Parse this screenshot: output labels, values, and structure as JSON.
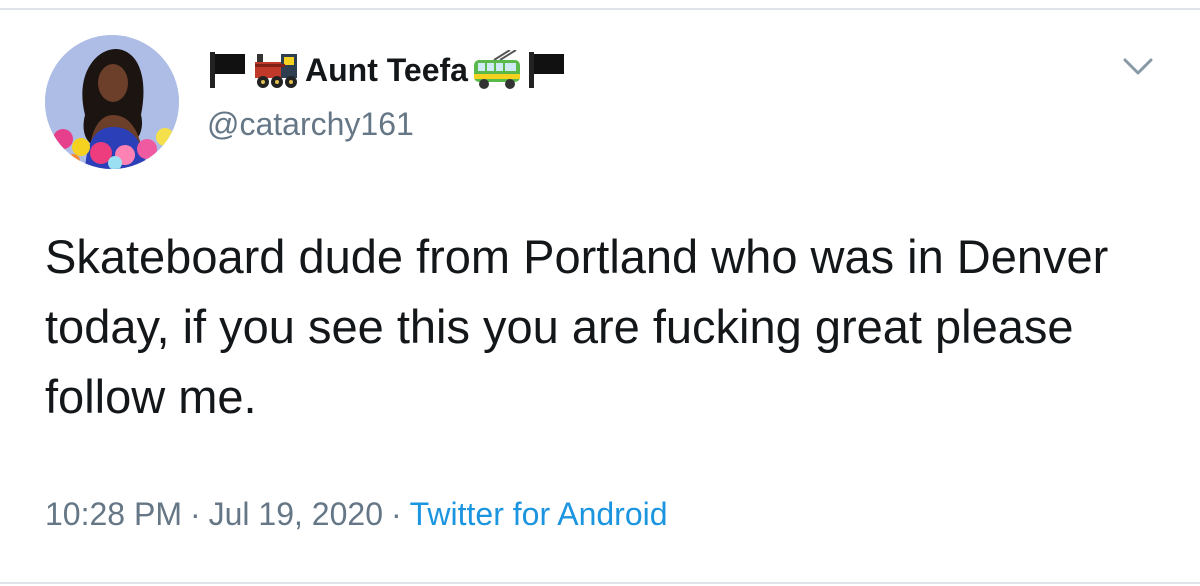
{
  "tweet": {
    "display_name": "Aunt Teefa",
    "handle": "@catarchy161",
    "text": "Skateboard dude from Portland who was in Denver today, if you see this you are fucking great please follow me.",
    "time": "10:28 PM",
    "separator": "·",
    "date": "Jul 19, 2020",
    "source": "Twitter for Android"
  },
  "icons": {
    "name_prefix": [
      "black-flag-icon",
      "locomotive-icon"
    ],
    "name_suffix": [
      "trolleybus-icon",
      "black-flag-icon"
    ],
    "menu": "chevron-down-icon"
  },
  "colors": {
    "name": "#14171a",
    "secondary": "#657786",
    "link": "#1b95e0",
    "divider": "#dfe3e7"
  }
}
